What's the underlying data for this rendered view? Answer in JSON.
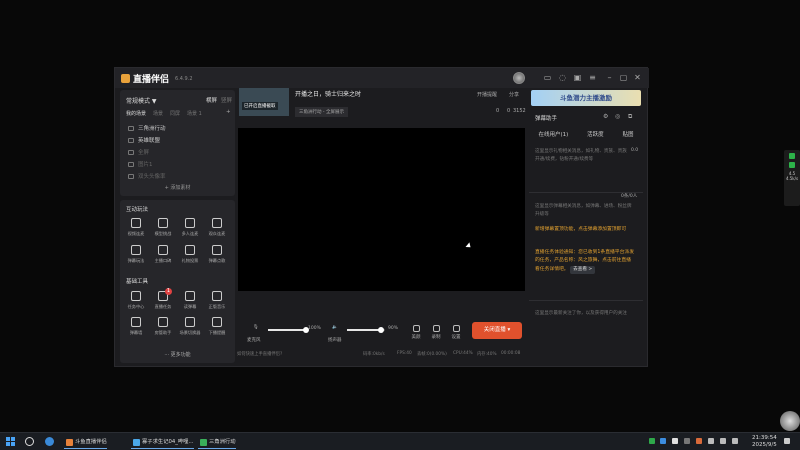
{
  "app": {
    "name": "直播伴侣",
    "version": "6.4.9.2"
  },
  "left": {
    "mode_label": "常规模式 ▼",
    "orientation": [
      "横屏",
      "竖屏"
    ],
    "scene_tabs": [
      "我的场景",
      "场景",
      "同屏",
      "场景 1"
    ],
    "scenes": [
      {
        "label": "三角洲行动",
        "dim": false
      },
      {
        "label": "英雄联盟",
        "dim": false
      },
      {
        "label": "全屏",
        "dim": true
      },
      {
        "label": "图片1",
        "dim": true
      },
      {
        "label": "双头头像率",
        "dim": true
      }
    ],
    "add_source": "+ 添加素材",
    "interactive_title": "互动玩法",
    "interactive_tools": [
      "视频连麦",
      "模型挑战",
      "多人连麦",
      "观众连麦",
      "弹幕玩法",
      "主播口碑",
      "礼物投票",
      "弹幕点歌"
    ],
    "basic_title": "基础工具",
    "basic_tools": [
      "任务中心",
      "直播任务",
      "读弹幕",
      "正版音乐",
      "弹幕墙",
      "房管助手",
      "场景切换器",
      "下播提醒"
    ],
    "badge_count": "1",
    "more": "··· 更多功能"
  },
  "center": {
    "thumb_caption": "已开启直播截取",
    "room_title": "开播之日，骑士归来之时",
    "room_category": "三角洲行动 - 全屏展示",
    "actions": [
      "开播提醒",
      "分享"
    ],
    "stats": [
      "0",
      "0",
      "3152"
    ],
    "mic_label": "麦克风",
    "mic_value": "100%",
    "speaker_label": "扬声器",
    "speaker_value": "90%",
    "mic_level": 1.0,
    "speaker_level": 0.9,
    "mini_buttons": [
      "美颜",
      "录制",
      "设置"
    ],
    "close_live": "关闭直播 ▾",
    "status": {
      "tip": "如何快速上手直播伴侣?",
      "bitrate": "码率:0kb/s",
      "fps": "FPS:40",
      "drop": "丢帧:0(0.00%)",
      "cpu": "CPU:44%",
      "mem": "内存:40%",
      "time": "00:00:08"
    }
  },
  "right": {
    "banner": "斗鱼潜力主播激励",
    "dm_title": "弹幕助手",
    "tabs": [
      "在线用户(1)",
      "活跃度",
      "贴图"
    ],
    "gift_tip": "这里显示礼物相关消息，如礼物、贵族、贵族开通/续费，钻粉开通/续费等",
    "gift_count": "0.0",
    "gift_ratio": "0条/0人",
    "dm_tip": "这里显示弹幕相关消息，如弹幕、进场、粉丝牌升级等",
    "notice1": "新增弹幕置顶功能，点击弹幕添加置顶即可",
    "notice2": "直播任务体验通知：您已收到1条直播平台派发的任务，产品名称：风之旅舞，点击前往直播看任务详情吧。",
    "notice_btn": "去查看 >",
    "follow_tip": "这里显示最新关注了你，以及获得用户的关注"
  },
  "taskbar": {
    "items": [
      "斗鱼直播伴侣",
      "寡子求生记04_哔哩...",
      "三角洲行动"
    ],
    "time": "21:39:54",
    "date": "2025/9/5"
  },
  "float": {
    "value1": "4.5",
    "value2": "4.5k/s"
  }
}
